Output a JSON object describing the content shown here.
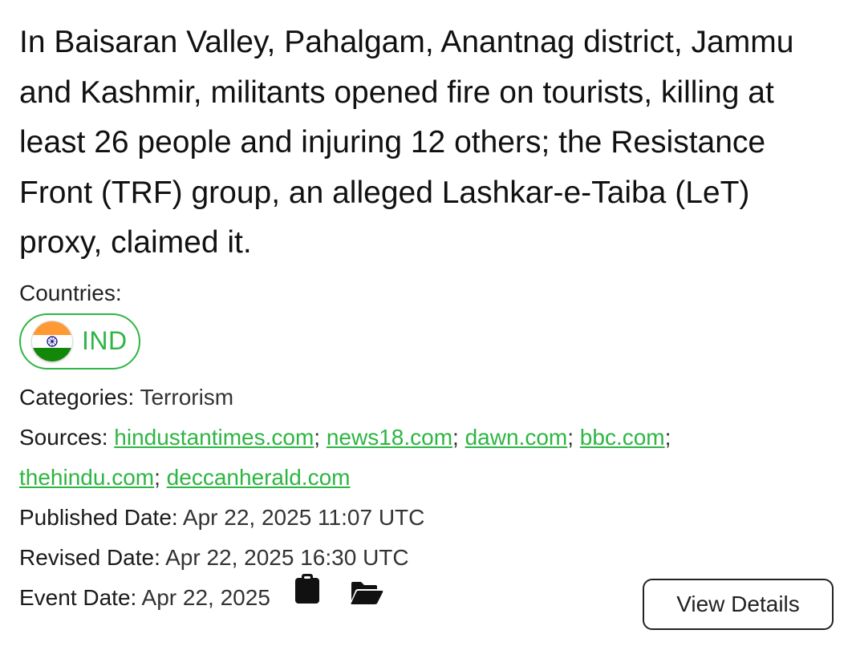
{
  "event": {
    "description": "In Baisaran Valley, Pahalgam, Anantnag district, Jammu and Kashmir, militants opened fire on tourists, killing at least 26 people and injuring 12 others; the Resistance Front (TRF) group, an alleged Lashkar-e-Taiba (LeT) proxy, claimed it."
  },
  "countries": {
    "label": "Countries:",
    "items": [
      {
        "code": "IND",
        "flag_icon": "india-flag-icon"
      }
    ]
  },
  "categories": {
    "label": "Categories:",
    "value": "Terrorism"
  },
  "sources": {
    "label": "Sources:",
    "separator": ";",
    "items": [
      "hindustantimes.com",
      "news18.com",
      "dawn.com",
      "bbc.com",
      "thehindu.com",
      "deccanherald.com"
    ]
  },
  "published": {
    "label": "Published Date:",
    "value": "Apr 22, 2025 11:07 UTC"
  },
  "revised": {
    "label": "Revised Date:",
    "value": "Apr 22, 2025 16:30 UTC"
  },
  "event_date": {
    "label": "Event Date:",
    "value": "Apr 22, 2025",
    "icons": [
      "clipboard-icon",
      "folder-open-icon"
    ]
  },
  "actions": {
    "view_details": "View Details"
  },
  "colors": {
    "accent": "#2eb543",
    "text": "#111111",
    "border": "#222222"
  }
}
